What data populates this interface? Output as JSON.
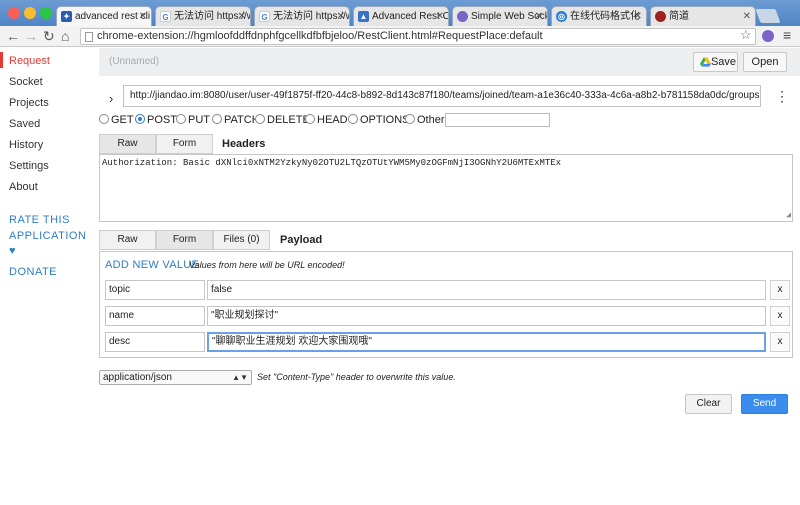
{
  "browser": {
    "tabs": [
      {
        "label": "advanced rest cli",
        "favicon": "paw-icon",
        "color": "#2a5db0"
      },
      {
        "label": "无法访问 https://w",
        "favicon": "google-icon",
        "color": "#ffffff"
      },
      {
        "label": "无法访问 https://w",
        "favicon": "google-icon",
        "color": "#ffffff"
      },
      {
        "label": "Advanced Rest Cli",
        "favicon": "arc-icon",
        "color": "#3a72c8"
      },
      {
        "label": "Simple Web Socke",
        "favicon": "socket-icon",
        "color": "#7a64c8"
      },
      {
        "label": "在线代码格式化",
        "favicon": "globe-icon",
        "color": "#2a7fd4"
      },
      {
        "label": "简道",
        "favicon": "avatar-icon",
        "color": "#a02020"
      }
    ],
    "address": "chrome-extension://hgmloofddffdnphfgcellkdfbfbjeloo/RestClient.html#RequestPlace:default"
  },
  "sidebar": {
    "items": [
      {
        "label": "Request"
      },
      {
        "label": "Socket"
      },
      {
        "label": "Projects"
      },
      {
        "label": "Saved"
      },
      {
        "label": "History"
      },
      {
        "label": "Settings"
      },
      {
        "label": "About"
      }
    ],
    "rate_line1": "RATE THIS",
    "rate_line2": "APPLICATION",
    "heart": "♥",
    "donate": "DONATE"
  },
  "toolbar": {
    "name_placeholder": "(Unnamed)",
    "save_label": "Save",
    "open_label": "Open"
  },
  "request": {
    "url": "http://jiandao.im:8080/user/user-49f1875f-ff20-44c8-b892-8d143c87f180/teams/joined/team-a1e36c40-333a-4c6a-a8b2-b781158da0dc/groups",
    "methods": [
      "GET",
      "POST",
      "PUT",
      "PATCH",
      "DELETE",
      "HEAD",
      "OPTIONS",
      "Other"
    ],
    "selected_method": "POST"
  },
  "headers": {
    "tabs": [
      "Raw",
      "Form"
    ],
    "selected_tab": "Raw",
    "title": "Headers",
    "raw_text": "Authorization: Basic dXNlci0xNTM2YzkyNy02OTU2LTQzOTUtYWM5My0zOGFmNjI3OGNhY2U6MTExMTEx"
  },
  "payload": {
    "tabs": [
      "Raw",
      "Form",
      "Files (0)"
    ],
    "selected_tab": "Form",
    "title": "Payload",
    "add_new": "ADD NEW VALUE",
    "encoded_note": "Values from here will be URL encoded!",
    "rows": [
      {
        "key": "topic",
        "value": "false",
        "delete": "x"
      },
      {
        "key": "name",
        "value": "\"职业规划探讨\"",
        "delete": "x"
      },
      {
        "key": "desc",
        "value": "\"聊聊职业生涯规划 欢迎大家围观哦\"",
        "delete": "x"
      }
    ]
  },
  "content_type": {
    "selected": "application/json",
    "note": "Set \"Content-Type\" header to overwrite this value."
  },
  "actions": {
    "clear_label": "Clear",
    "send_label": "Send"
  },
  "colors": {
    "accent": "#2e7dc5",
    "active_nav": "#e53935",
    "send_button": "#3b8ded"
  }
}
